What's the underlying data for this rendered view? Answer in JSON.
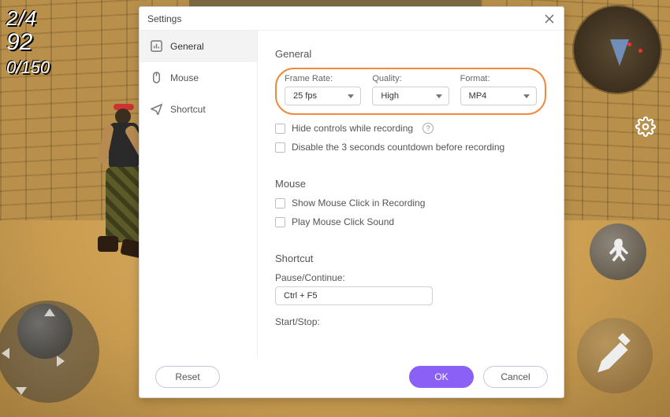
{
  "hud": {
    "line1": "2/4",
    "line2": "92",
    "line3": "0/150"
  },
  "dialog": {
    "title": "Settings",
    "sidebar": {
      "items": [
        {
          "label": "General"
        },
        {
          "label": "Mouse"
        },
        {
          "label": "Shortcut"
        }
      ]
    },
    "general": {
      "heading": "General",
      "frame_rate_label": "Frame Rate:",
      "frame_rate_value": "25 fps",
      "quality_label": "Quality:",
      "quality_value": "High",
      "format_label": "Format:",
      "format_value": "MP4",
      "hide_controls_label": "Hide controls while recording",
      "disable_countdown_label": "Disable the 3 seconds countdown before recording"
    },
    "mouse": {
      "heading": "Mouse",
      "show_click_label": "Show Mouse Click in Recording",
      "play_sound_label": "Play Mouse Click Sound"
    },
    "shortcut": {
      "heading": "Shortcut",
      "pause_label": "Pause/Continue:",
      "pause_value": "Ctrl + F5",
      "startstop_label": "Start/Stop:"
    },
    "buttons": {
      "reset": "Reset",
      "ok": "OK",
      "cancel": "Cancel"
    }
  },
  "colors": {
    "accent": "#8a60f6",
    "highlight": "#f0893c"
  }
}
